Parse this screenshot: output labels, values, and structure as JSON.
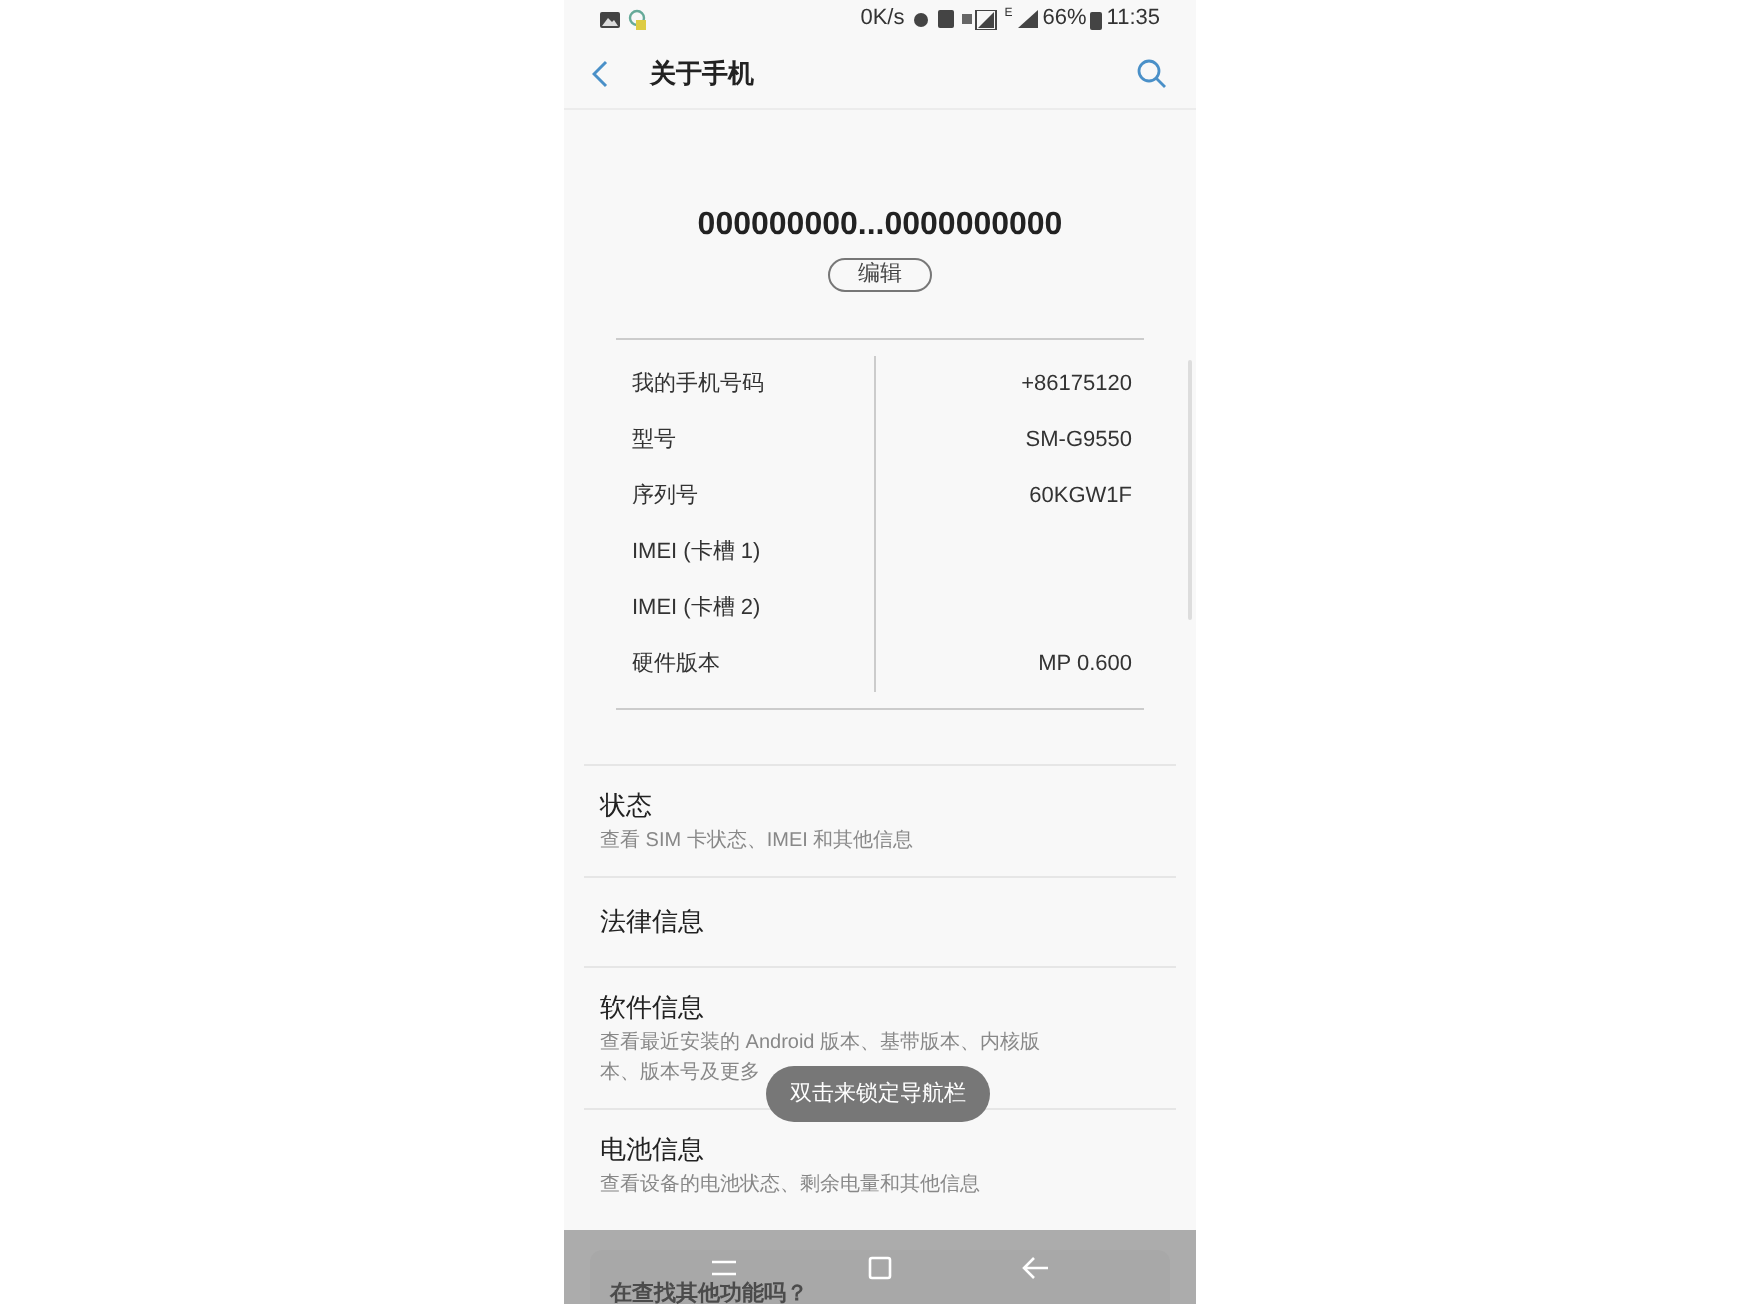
{
  "status_bar": {
    "speed": "0K/s",
    "network": "E",
    "battery": "66%",
    "time": "11:35"
  },
  "header": {
    "title": "关于手机"
  },
  "device": {
    "name": "000000000...0000000000",
    "edit_button": "编辑"
  },
  "info_rows": [
    {
      "label": "我的手机号码",
      "value": "+86175120"
    },
    {
      "label": "型号",
      "value": "SM-G9550"
    },
    {
      "label": "序列号",
      "value": "60KGW1F"
    },
    {
      "label": "IMEI (卡槽 1)",
      "value": ""
    },
    {
      "label": "IMEI (卡槽 2)",
      "value": ""
    },
    {
      "label": "硬件版本",
      "value": "MP 0.600"
    }
  ],
  "menu_items": [
    {
      "title": "状态",
      "subtitle": "查看 SIM 卡状态、IMEI 和其他信息"
    },
    {
      "title": "法律信息"
    },
    {
      "title": "软件信息",
      "subtitle": "查看最近安装的 Android 版本、基带版本、内核版本、版本号及更多"
    },
    {
      "title": "电池信息",
      "subtitle": "查看设备的电池状态、剩余电量和其他信息"
    }
  ],
  "toast": "双击来锁定导航栏",
  "suggestion_card": {
    "title": "在查找其他功能吗？"
  }
}
